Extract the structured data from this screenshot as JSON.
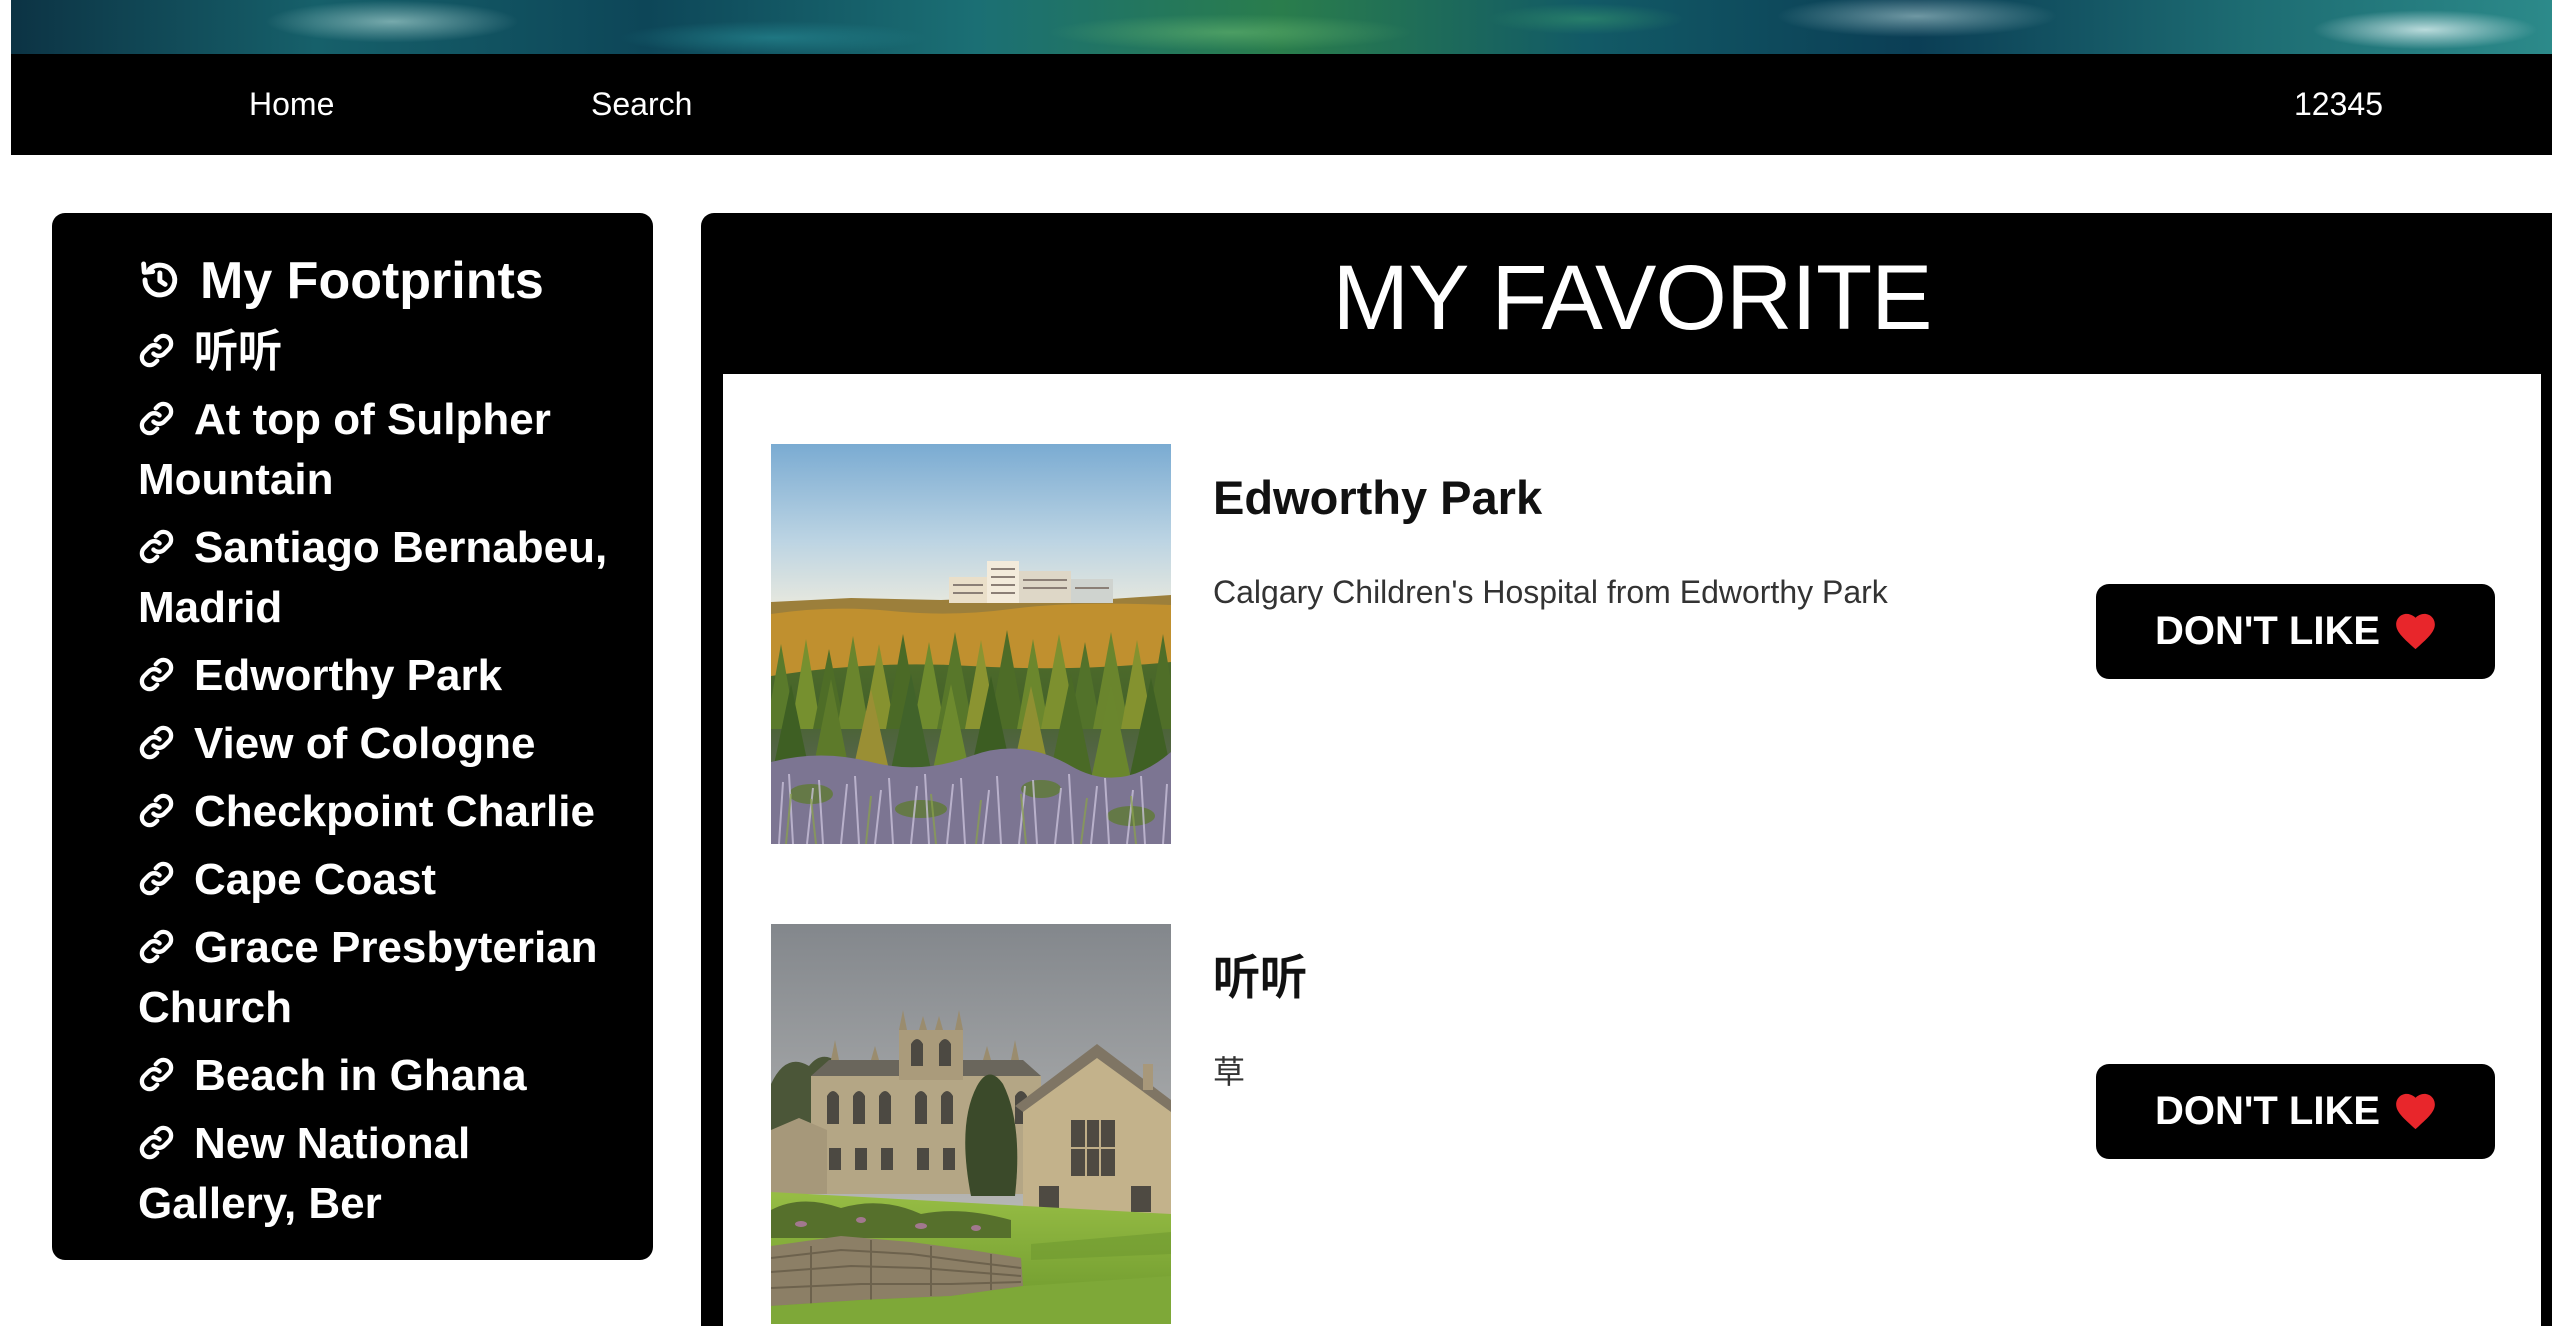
{
  "nav": {
    "home": "Home",
    "search": "Search",
    "user": "12345"
  },
  "sidebar": {
    "title": "My Footprints",
    "title_icon": "history-icon",
    "item_icon": "link-icon",
    "items": [
      "听听",
      "At top of Sulpher Mountain",
      "Santiago Bernabeu, Madrid",
      "Edworthy Park",
      "View of Cologne",
      "Checkpoint Charlie",
      "Cape Coast",
      "Grace Presbyterian Church",
      "Beach in Ghana",
      "New National Gallery, Ber"
    ]
  },
  "main": {
    "title": "MY FAVORITE",
    "cards": [
      {
        "title": "Edworthy Park",
        "description": "Calgary Children's Hospital from Edworthy Park",
        "button_label": "DON'T LIKE",
        "button_icon": "heart-icon"
      },
      {
        "title": "听听",
        "description": "草",
        "button_label": "DON'T LIKE",
        "button_icon": "heart-icon"
      }
    ]
  },
  "colors": {
    "page_background": "#ffffff",
    "panel": "#000000",
    "panel_text": "#ffffff",
    "heart": "#e8262b"
  }
}
